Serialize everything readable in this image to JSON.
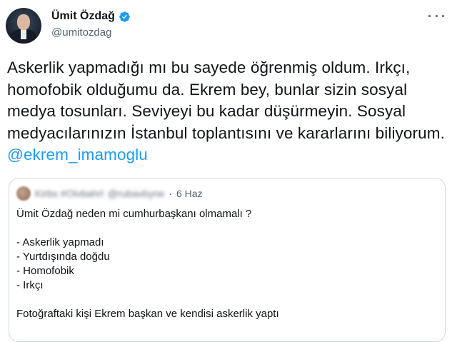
{
  "author": {
    "display_name": "Ümit Özdağ",
    "handle": "@umitozdag"
  },
  "icons": {
    "verified": "verified-badge-icon",
    "more": "more-options-icon"
  },
  "tweet": {
    "text": "Askerlik yapmadığı mı bu sayede öğrenmiş oldum. Irkçı, homofobik olduğumu da. Ekrem bey, bunlar sizin sosyal medya tosunları. Seviyeyi bu kadar düşürmeyin. Sosyal medyacılarınızın İstanbul toplantısını ve kararlarını biliyorum.",
    "mention": "@ekrem_imamoglu"
  },
  "quote": {
    "blurred_name": "Kirbs #Olvbahrl",
    "blurred_handle": "@rubavbyne",
    "date": "6 Haz",
    "title": "Ümit Özdağ neden mi cumhurbaşkanı olmamalı ?",
    "items": [
      "- Askerlik yapmadı",
      "- Yurtdışında doğdu",
      "- Homofobik",
      "- Irkçı"
    ],
    "footer": "Fotoğraftaki kişi Ekrem başkan ve kendisi askerlik yaptı"
  },
  "colors": {
    "text": "#0f1419",
    "secondary": "#536471",
    "accent": "#1d9bf0",
    "border": "#cfd9de"
  }
}
